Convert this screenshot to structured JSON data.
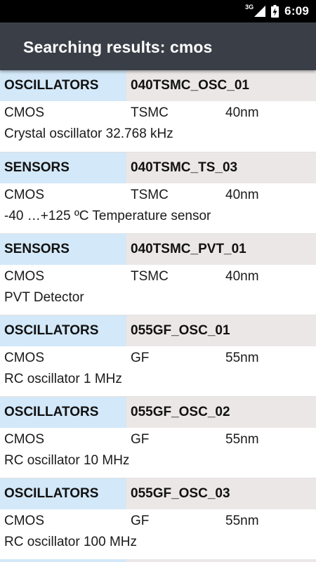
{
  "status_bar": {
    "network_type": "3G",
    "time": "6:09",
    "icons": [
      "signal-icon",
      "battery-charging-icon"
    ]
  },
  "app_bar": {
    "title": "Searching results: cmos"
  },
  "results": [
    {
      "category": "OSCILLATORS",
      "code": "040TSMC_OSC_01",
      "technology": "CMOS",
      "foundry": "TSMC",
      "node": "40nm",
      "description": "Crystal oscillator 32.768 kHz"
    },
    {
      "category": "SENSORS",
      "code": "040TSMC_TS_03",
      "technology": "CMOS",
      "foundry": "TSMC",
      "node": "40nm",
      "description": "-40 …+125 ºC Temperature sensor"
    },
    {
      "category": "SENSORS",
      "code": "040TSMC_PVT_01",
      "technology": "CMOS",
      "foundry": "TSMC",
      "node": "40nm",
      "description": "PVT Detector"
    },
    {
      "category": "OSCILLATORS",
      "code": "055GF_OSC_01",
      "technology": "CMOS",
      "foundry": "GF",
      "node": "55nm",
      "description": "RC oscillator 1 MHz"
    },
    {
      "category": "OSCILLATORS",
      "code": "055GF_OSC_02",
      "technology": "CMOS",
      "foundry": "GF",
      "node": "55nm",
      "description": "RC oscillator 10 MHz"
    },
    {
      "category": "OSCILLATORS",
      "code": "055GF_OSC_03",
      "technology": "CMOS",
      "foundry": "GF",
      "node": "55nm",
      "description": "RC oscillator 100 MHz"
    }
  ],
  "colors": {
    "app_bar": "#3a3f47",
    "category_bg": "#d3e8f8",
    "code_bg": "#ece7e7"
  }
}
